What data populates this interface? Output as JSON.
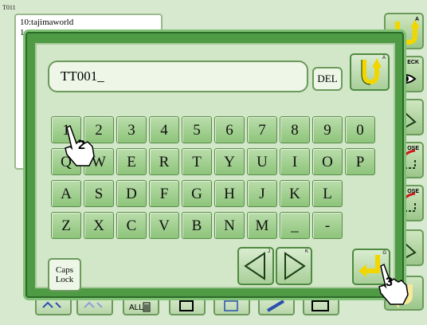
{
  "background": {
    "code": "T011",
    "list_items": [
      "10:tajimaworld",
      "1"
    ]
  },
  "right_bar": {
    "buttons": [
      {
        "label": "A",
        "icon": "return-arrow-icon"
      },
      {
        "label": "ECK",
        "icon": "eye-icon"
      },
      {
        "label": "",
        "icon": "triangle-icon"
      },
      {
        "label": "OSE",
        "icon": "needle-icon"
      },
      {
        "label": "OSE",
        "icon": "needle-icon"
      },
      {
        "label": "",
        "icon": "triangle-icon"
      },
      {
        "label": "",
        "icon": "return-arrow-icon"
      }
    ]
  },
  "bottom_bar": {
    "all_label": "ALL"
  },
  "dialog": {
    "name_value": "TT001_",
    "del_label": "DEL",
    "ok_corner": "A",
    "caps_label_1": "Caps",
    "caps_label_2": "Lock",
    "left_corner": "J",
    "right_corner": "K",
    "enter_corner": "G",
    "keys": [
      [
        "1",
        "2",
        "3",
        "4",
        "5",
        "6",
        "7",
        "8",
        "9",
        "0"
      ],
      [
        "Q",
        "W",
        "E",
        "R",
        "T",
        "Y",
        "U",
        "I",
        "O",
        "P"
      ],
      [
        "A",
        "S",
        "D",
        "F",
        "G",
        "H",
        "J",
        "K",
        "L"
      ],
      [
        "Z",
        "X",
        "C",
        "V",
        "B",
        "N",
        "M",
        "_",
        "-"
      ]
    ]
  },
  "hands": [
    {
      "number": "2"
    },
    {
      "number": "3"
    }
  ],
  "colors": {
    "dialog_frame": "#4f9a45",
    "key_face": "#8ec47b",
    "arrow_yellow": "#f2d600"
  }
}
